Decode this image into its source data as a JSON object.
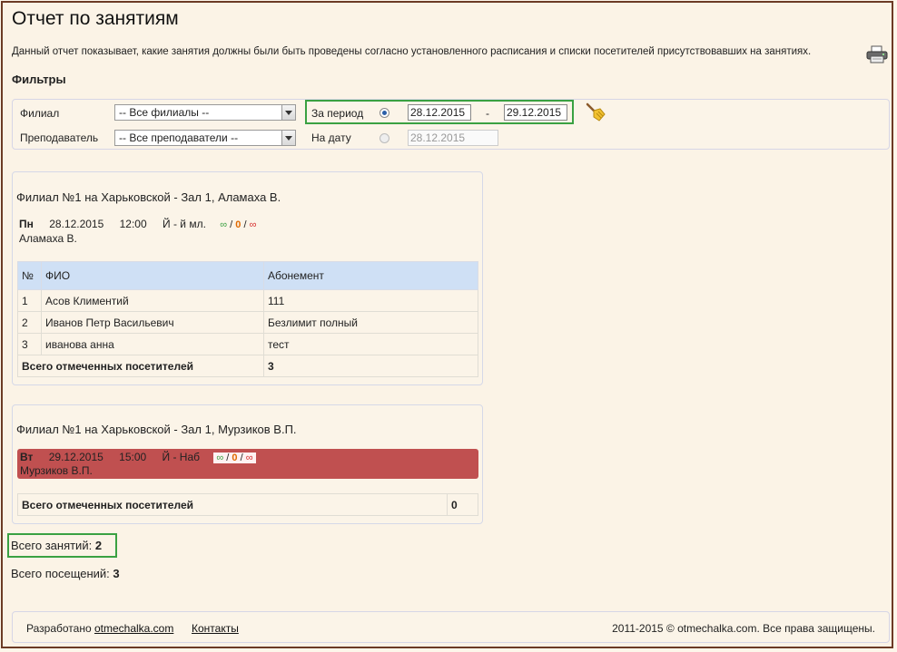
{
  "page": {
    "title": "Отчет по занятиям",
    "description": "Данный отчет показывает, какие занятия должны были быть проведены согласно установленного расписания и списки посетителей присутствовавших на занятиях.",
    "filters_heading": "Фильтры"
  },
  "filters": {
    "branch_label": "Филиал",
    "branch_value": "-- Все филиалы --",
    "teacher_label": "Преподаватель",
    "teacher_value": "-- Все преподаватели --",
    "period_label": "За период",
    "period_from": "28.12.2015",
    "period_sep": "-",
    "period_to": "29.12.2015",
    "date_label": "На дату",
    "date_value": "28.12.2015"
  },
  "lessons": [
    {
      "title": "Филиал №1 на Харьковской - Зал 1, Аламаха В.",
      "day": "Пн",
      "date": "28.12.2015",
      "time": "12:00",
      "group": "Й - й мл.",
      "c1": "∞",
      "c2": "0",
      "c3": "∞",
      "sep": "/",
      "teacher": "Аламаха В.",
      "headers": [
        "№",
        "ФИО",
        "Абонемент"
      ],
      "rows": [
        {
          "n": "1",
          "name": "Асов Климентий",
          "sub": "111"
        },
        {
          "n": "2",
          "name": "Иванов Петр Васильевич",
          "sub": "Безлимит полный"
        },
        {
          "n": "3",
          "name": "иванова анна",
          "sub": "тест"
        }
      ],
      "total_label": "Всего отмеченных посетителей",
      "total_value": "3"
    },
    {
      "title": "Филиал №1 на Харьковской - Зал 1, Мурзиков В.П.",
      "day": "Вт",
      "date": "29.12.2015",
      "time": "15:00",
      "group": "Й - Наб",
      "c1": "∞",
      "c2": "0",
      "c3": "∞",
      "sep": "/",
      "teacher": "Мурзиков В.П.",
      "total_label": "Всего отмеченных посетителей",
      "total_value": "0"
    }
  ],
  "summary": {
    "lessons_label": "Всего занятий:",
    "lessons_value": "2",
    "visits_label": "Всего посещений:",
    "visits_value": "3"
  },
  "footer": {
    "dev_prefix": "Разработано",
    "dev_link": "otmechalka.com",
    "contacts": "Контакты",
    "copyright": "2011-2015 © otmechalka.com. Все права защищены."
  },
  "colors": {
    "highlight": "#3aa142",
    "missed_lesson": "#c05050",
    "table_header": "#cfe0f5",
    "frame": "#6b3b25"
  },
  "icons": [
    "printer-icon",
    "broom-icon",
    "dropdown-arrow-icon"
  ]
}
